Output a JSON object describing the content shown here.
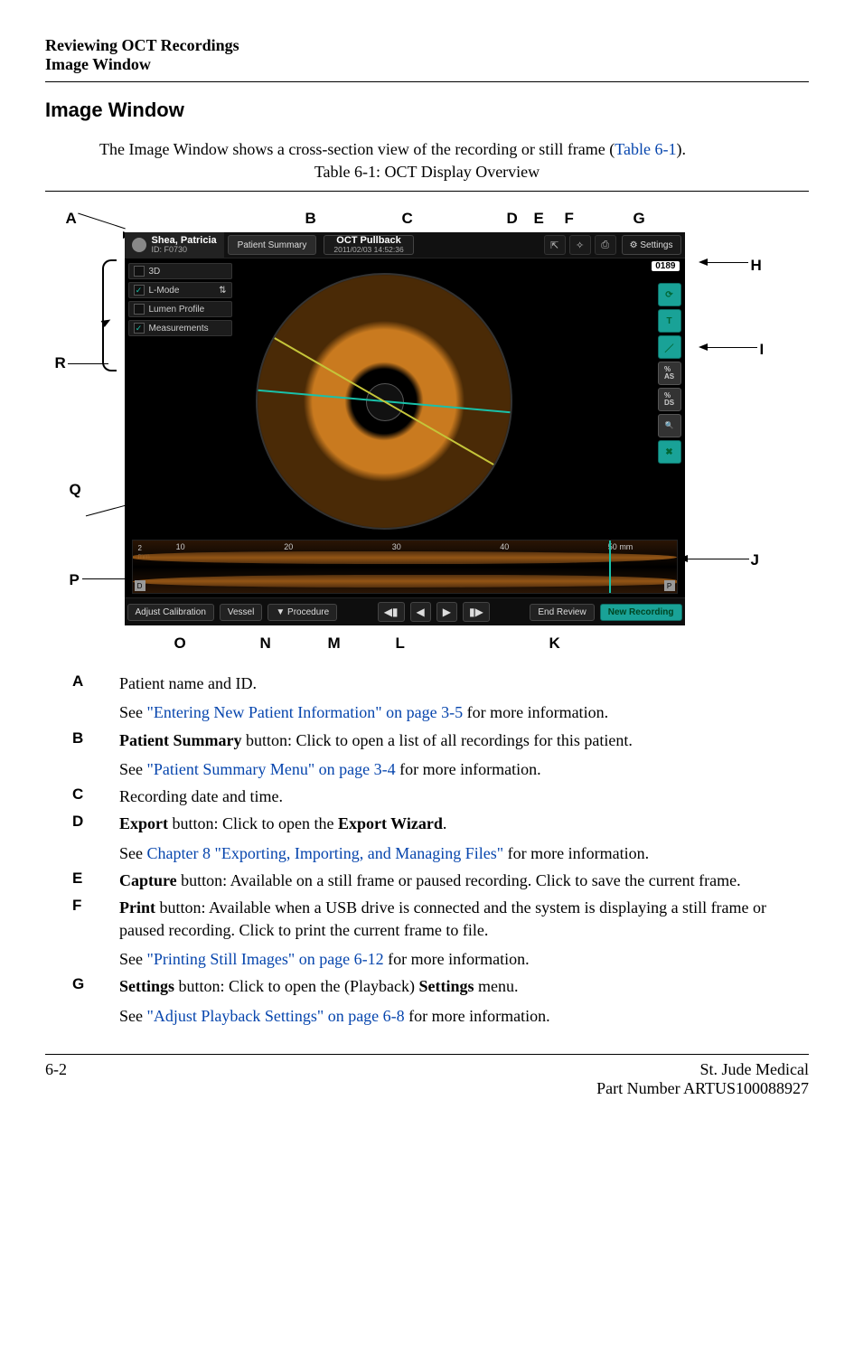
{
  "header": {
    "line1": "Reviewing OCT Recordings",
    "line2": "Image Window"
  },
  "section_title": "Image Window",
  "intro_text_pre": "The Image Window shows a cross-section view of the recording or still frame (",
  "intro_link": "Table 6-1",
  "intro_text_post": ").",
  "table_caption": "Table 6-1:  OCT Display Overview",
  "labels": {
    "A": "A",
    "B": "B",
    "C": "C",
    "D": "D",
    "E": "E",
    "F": "F",
    "G": "G",
    "H": "H",
    "I": "I",
    "J": "J",
    "K": "K",
    "L": "L",
    "M": "M",
    "N": "N",
    "O": "O",
    "P": "P",
    "Q": "Q",
    "R": "R"
  },
  "screenshot": {
    "patient_name": "Shea, Patricia",
    "patient_id": "ID: F0730",
    "patient_summary_btn": "Patient Summary",
    "title_main": "OCT Pullback",
    "title_sub": "2011/02/03 14:52:36",
    "settings_btn": "Settings",
    "frame_number": "0189",
    "opts": {
      "threeD": "3D",
      "lmode": "L-Mode",
      "lumen": "Lumen Profile",
      "meas": "Measurements"
    },
    "tool_as": "%\nAS",
    "tool_ds": "%\nDS",
    "lmode_ticks": {
      "t10": "10",
      "t20": "20",
      "t30": "30",
      "t40": "40",
      "t50": "50",
      "unit": "mm"
    },
    "lmode_mm_top": "2\nmm",
    "lmode_mm_bot": "2",
    "marker_d": "D",
    "marker_p": "P",
    "bottom": {
      "adjust": "Adjust Calibration",
      "vessel": "Vessel",
      "procedure": "▼ Procedure",
      "step_back": "◀▮",
      "play_back": "◀",
      "play_fwd": "▶",
      "step_fwd": "▮▶",
      "end_review": "End Review",
      "new_recording": "New Recording"
    }
  },
  "defs": {
    "A": {
      "main": "Patient name and ID.",
      "sub_pre": "See ",
      "sub_link": "\"Entering New Patient Information\" on page 3-5",
      "sub_post": " for more information."
    },
    "B": {
      "main_pre": "",
      "main_bold": "Patient Summary",
      "main_post": " button: Click to open a list of all recordings for this patient.",
      "sub_pre": "See ",
      "sub_link": "\"Patient Summary Menu\" on page 3-4",
      "sub_post": " for more information."
    },
    "C": {
      "main": "Recording date and time."
    },
    "D": {
      "main_pre": "",
      "main_bold": "Export",
      "main_mid": " button: Click to open the ",
      "main_bold2": "Export Wizard",
      "main_post": ".",
      "sub_pre": "See ",
      "sub_link": "Chapter 8 \"Exporting, Importing, and Managing Files\"",
      "sub_post": " for more information."
    },
    "E": {
      "main_pre": "",
      "main_bold": "Capture",
      "main_post": " button: Available on a still frame or paused recording. Click to save the current frame."
    },
    "F": {
      "main_pre": "",
      "main_bold": "Print",
      "main_post": " button: Available when a USB drive is connected and the system is displaying a still frame or paused recording. Click to print the current frame to file.",
      "sub_pre": "See ",
      "sub_link": "\"Printing Still Images\" on page 6-12",
      "sub_post": " for more information."
    },
    "G": {
      "main_pre": "",
      "main_bold": "Settings",
      "main_mid": " button: Click to open the (Playback) ",
      "main_bold2": "Settings",
      "main_post": " menu.",
      "sub_pre": "See ",
      "sub_link": "\"Adjust Playback Settings\" on page 6-8",
      "sub_post": " for more information."
    }
  },
  "footer": {
    "page": "6-2",
    "company": "St. Jude Medical",
    "part": "Part Number ARTUS100088927"
  }
}
